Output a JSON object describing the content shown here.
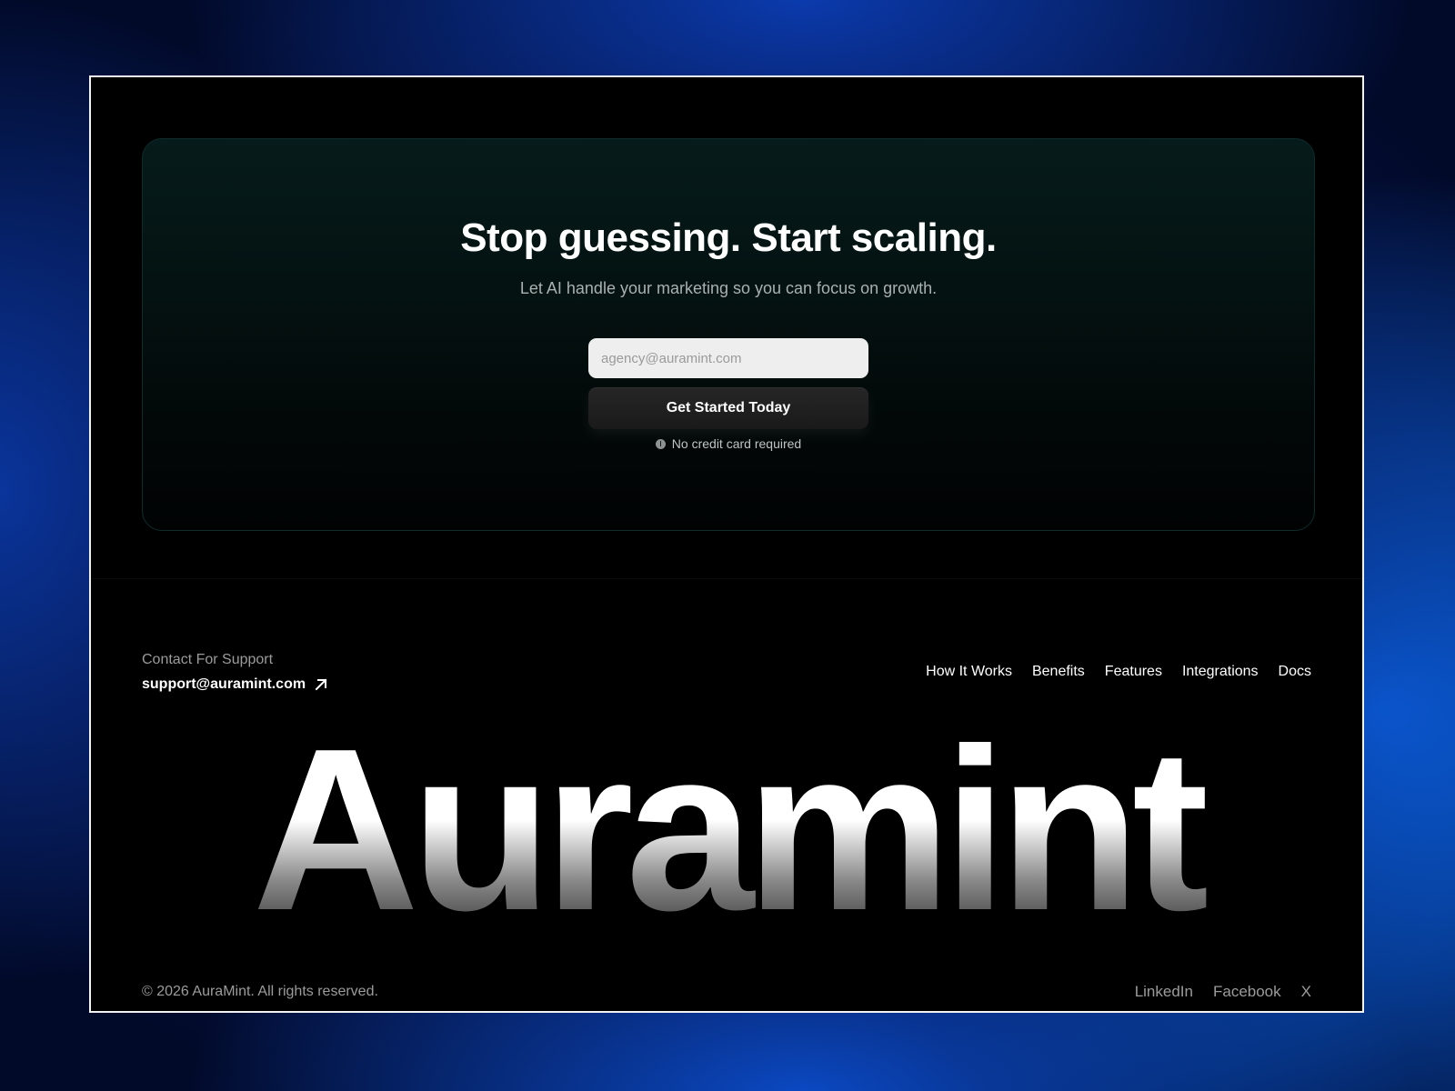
{
  "cta": {
    "title": "Stop guessing. Start scaling.",
    "subtitle": "Let AI handle your marketing so you can focus on growth.",
    "email_placeholder": "agency@auramint.com",
    "button_label": "Get Started Today",
    "note": "No credit card required"
  },
  "footer": {
    "contact_label": "Contact For Support",
    "contact_email": "support@auramint.com",
    "nav": [
      {
        "label": "How It Works"
      },
      {
        "label": "Benefits"
      },
      {
        "label": "Features"
      },
      {
        "label": "Integrations"
      },
      {
        "label": "Docs"
      }
    ],
    "wordmark": "Auramint",
    "copyright": "© 2026 AuraMint. All rights reserved.",
    "social": [
      {
        "label": "LinkedIn"
      },
      {
        "label": "Facebook"
      },
      {
        "label": "X"
      }
    ]
  },
  "icons": {
    "info": "info-icon",
    "external_link": "arrow-up-right-icon"
  },
  "colors": {
    "frame_border": "#f2f2f2",
    "page_bg": "#000000",
    "accent_glow": "#0a64e8"
  }
}
